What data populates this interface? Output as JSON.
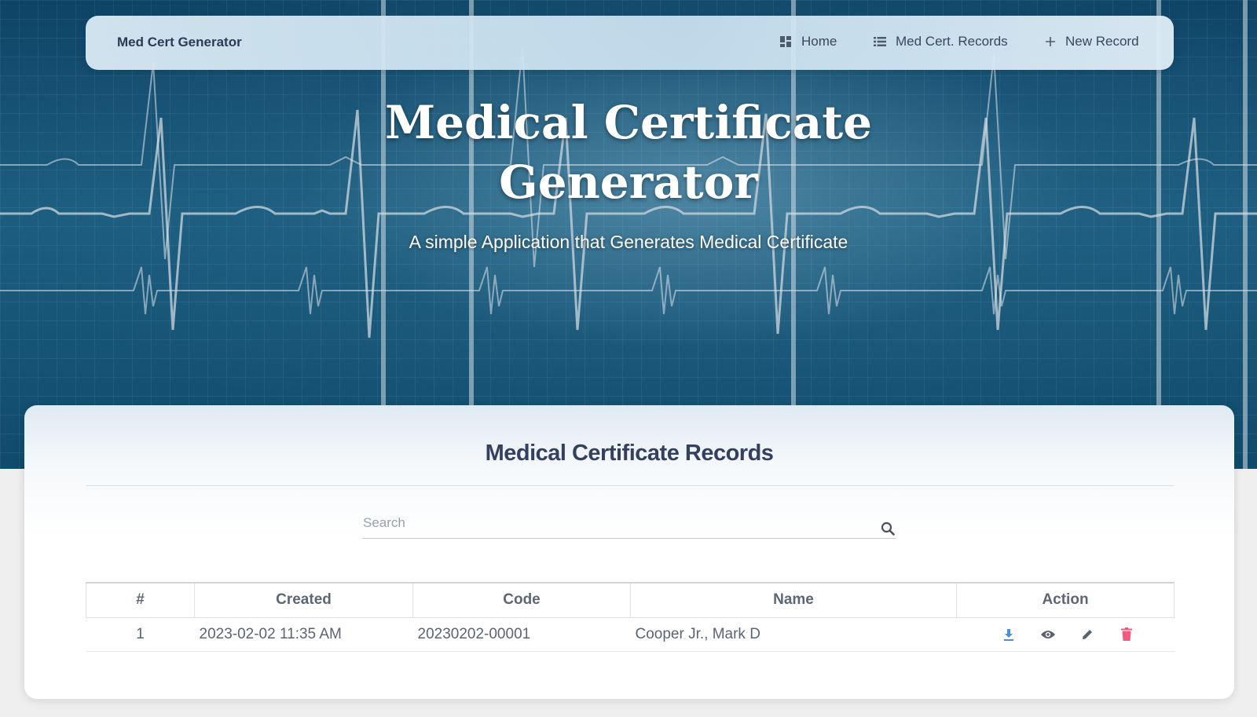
{
  "navbar": {
    "brand": "Med Cert Generator",
    "items": [
      {
        "label": "Home",
        "icon": "dashboard-icon"
      },
      {
        "label": "Med Cert. Records",
        "icon": "list-icon"
      },
      {
        "label": "New Record",
        "icon": "plus-icon"
      }
    ]
  },
  "hero": {
    "title_line1": "Medical Certificate",
    "title_line2": "Generator",
    "subtitle": "A simple Application that Generates Medical Certificate"
  },
  "records": {
    "title": "Medical Certificate Records",
    "search_placeholder": "Search",
    "columns": [
      "#",
      "Created",
      "Code",
      "Name",
      "Action"
    ],
    "rows": [
      {
        "num": "1",
        "created": "2023-02-02 11:35 AM",
        "code": "20230202-00001",
        "name": "Cooper Jr., Mark D"
      }
    ],
    "action_icons": [
      "download-icon",
      "eye-icon",
      "pencil-icon",
      "trash-icon"
    ]
  },
  "colors": {
    "hero_bg": "#1d5e80",
    "heading": "#34405f",
    "download": "#4a90d9",
    "trash": "#ef5a7d"
  }
}
